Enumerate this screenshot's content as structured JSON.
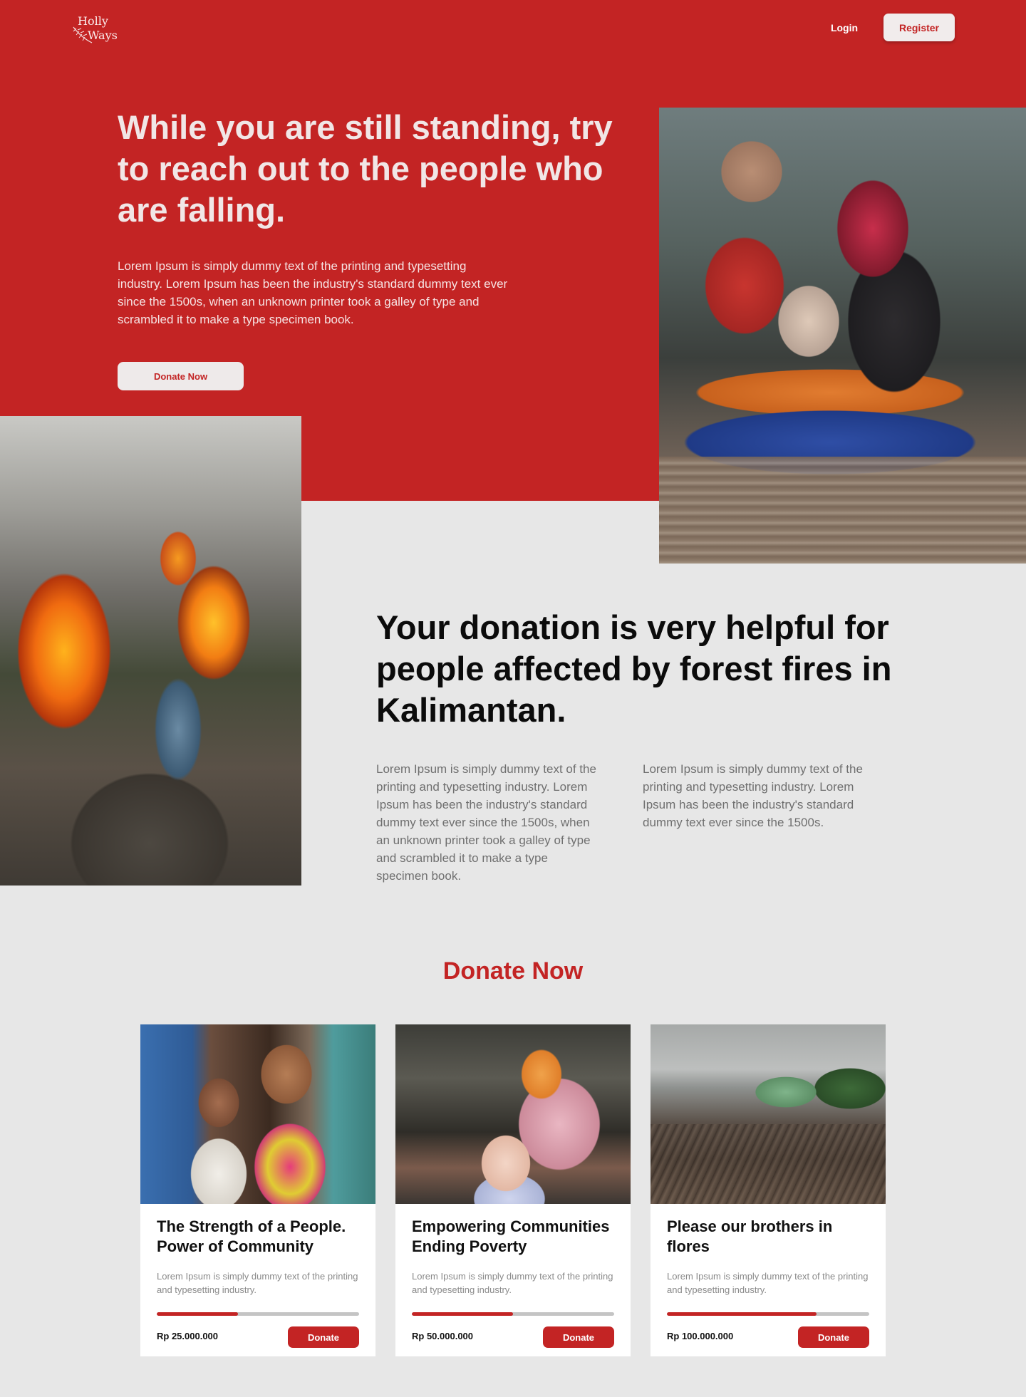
{
  "header": {
    "logo_line1": "Holly",
    "logo_line2": "Ways",
    "login_label": "Login",
    "register_label": "Register"
  },
  "hero": {
    "title": "While you are still standing, try to reach out to the people who are falling.",
    "text": "Lorem Ipsum is simply dummy text of the printing and typesetting industry. Lorem Ipsum has been the industry's standard dummy text ever since the 1500s, when an unknown printer took a galley of type and scrambled it to make a type specimen book.",
    "donate_label": "Donate Now"
  },
  "mid": {
    "title": "Your donation is very helpful for people affected by forest fires in Kalimantan.",
    "text_left": "Lorem Ipsum is simply dummy text of the printing and typesetting industry. Lorem Ipsum has been the industry's standard dummy text ever since the 1500s, when an unknown printer took a galley of type and scrambled it to make a type specimen book.",
    "text_right": "Lorem Ipsum is simply dummy text of the printing and typesetting industry. Lorem Ipsum has been the industry's standard dummy text ever since the 1500s."
  },
  "donate_section": {
    "heading": "Donate Now",
    "cards": [
      {
        "title": "The Strength of a People. Power of Community",
        "description": "Lorem Ipsum is simply dummy text of the printing and typesetting industry.",
        "progress": 0.4,
        "amount": "Rp 25.000.000",
        "button_label": "Donate"
      },
      {
        "title": "Empowering Communities Ending Poverty",
        "description": "Lorem Ipsum is simply dummy text of the printing and typesetting industry.",
        "progress": 0.5,
        "amount": "Rp 50.000.000",
        "button_label": "Donate"
      },
      {
        "title": "Please our brothers in flores",
        "description": "Lorem Ipsum is simply dummy text of the printing and typesetting industry.",
        "progress": 0.74,
        "amount": "Rp 100.000.000",
        "button_label": "Donate"
      }
    ]
  },
  "colors": {
    "brand_red": "#c32424",
    "page_background": "#e7e7e7"
  }
}
